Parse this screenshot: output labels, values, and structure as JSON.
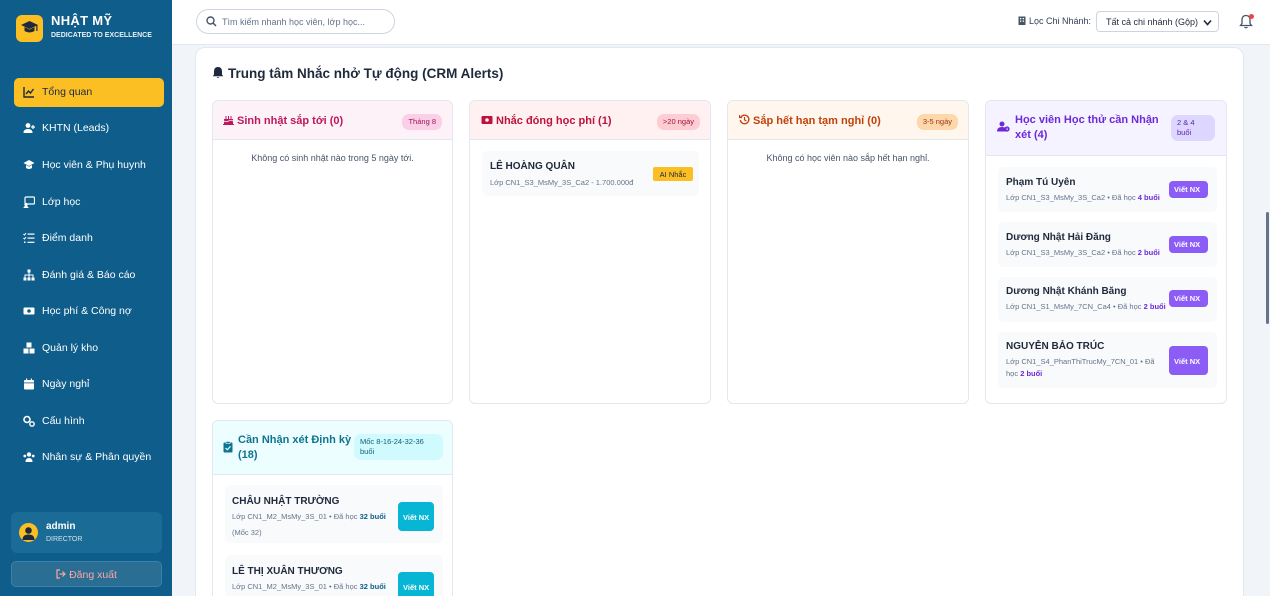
{
  "brand": {
    "name": "NHẬT MỸ",
    "tagline": "DEDICATED TO EXCELLENCE"
  },
  "nav": [
    {
      "label": "Tổng quan",
      "icon": "chart-line-icon",
      "active": true
    },
    {
      "label": "KHTN (Leads)",
      "icon": "user-plus-icon"
    },
    {
      "label": "Học viên & Phụ huynh",
      "icon": "graduation-cap-icon"
    },
    {
      "label": "Lớp học",
      "icon": "chalkboard-icon"
    },
    {
      "label": "Điểm danh",
      "icon": "list-check-icon"
    },
    {
      "label": "Đánh giá & Báo cáo",
      "icon": "sitemap-icon"
    },
    {
      "label": "Học phí & Công nợ",
      "icon": "money-icon"
    },
    {
      "label": "Quản lý kho",
      "icon": "boxes-icon"
    },
    {
      "label": "Ngày nghỉ",
      "icon": "calendar-icon"
    },
    {
      "label": "Cấu hình",
      "icon": "gears-icon"
    },
    {
      "label": "Nhân sự & Phân quyền",
      "icon": "users-icon"
    }
  ],
  "user": {
    "name": "admin",
    "role": "DIRECTOR"
  },
  "logout_label": "Đăng xuất",
  "search": {
    "placeholder": "Tìm kiếm nhanh học viên, lớp học..."
  },
  "branch": {
    "label": "Lọc Chi Nhánh:",
    "selected": "Tất cả chi nhánh (Gộp)"
  },
  "panel": {
    "title": "Trung tâm Nhắc nhở Tự động (CRM Alerts)",
    "cards": {
      "birthday": {
        "title": "Sinh nhật sắp tới (0)",
        "badge": "Tháng 8",
        "empty": "Không có sinh nhật nào trong 5 ngày tới.",
        "color": "#be185d"
      },
      "fee": {
        "title": "Nhắc đóng học phí (1)",
        "badge": ">20 ngày",
        "color": "#be123c",
        "items": [
          {
            "name": "LÊ HOÀNG QUÂN",
            "sub": "Lớp CN1_S3_MsMy_3S_Ca2 - 1.700.000đ",
            "button": "AI Nhắc"
          }
        ]
      },
      "leave": {
        "title": "Sắp hết hạn tạm nghỉ (0)",
        "badge": "3-5 ngày",
        "empty": "Không có học viên nào sắp hết hạn nghỉ.",
        "color": "#c2410c"
      },
      "trial": {
        "title": "Học viên Học thử cần Nhận xét (4)",
        "badge": "2 & 4 buổi",
        "color": "#6d28d9",
        "items": [
          {
            "name": "Phạm Tú Uyên",
            "sub": "Lớp CN1_S3_MsMy_3S_Ca2 • Đã học",
            "count": "4 buổi",
            "button": "Viết NX"
          },
          {
            "name": "Dương Nhật Hải Đăng",
            "sub": "Lớp CN1_S3_MsMy_3S_Ca2 • Đã học",
            "count": "2 buổi",
            "button": "Viết NX"
          },
          {
            "name": "Dương Nhật Khánh Băng",
            "sub": "Lớp CN1_S1_MsMy_7CN_Ca4 • Đã học",
            "count": "2 buổi",
            "button": "Viết NX"
          },
          {
            "name": "NGUYỄN BẢO TRÚC",
            "sub": "Lớp CN1_S4_PhanThiTrucMy_7CN_01 • Đã học",
            "count": "2 buổi",
            "button": "Viết NX"
          }
        ]
      },
      "periodic": {
        "title": "Cần Nhận xét Định kỳ (18)",
        "badge": "Mốc 8-16-24-32-36 buổi",
        "color": "#0e7490",
        "items": [
          {
            "name": "CHÂU NHẬT TRƯỜNG",
            "sub": "Lớp CN1_M2_MsMy_3S_01 • Đã học",
            "count": "32 buổi",
            "mark": "(Mốc 32)",
            "button": "Viết NX"
          },
          {
            "name": "LÊ THỊ XUÂN THƯƠNG",
            "sub": "Lớp CN1_M2_MsMy_3S_01 • Đã học",
            "count": "32 buổi",
            "button": "Viết NX"
          }
        ]
      }
    }
  }
}
